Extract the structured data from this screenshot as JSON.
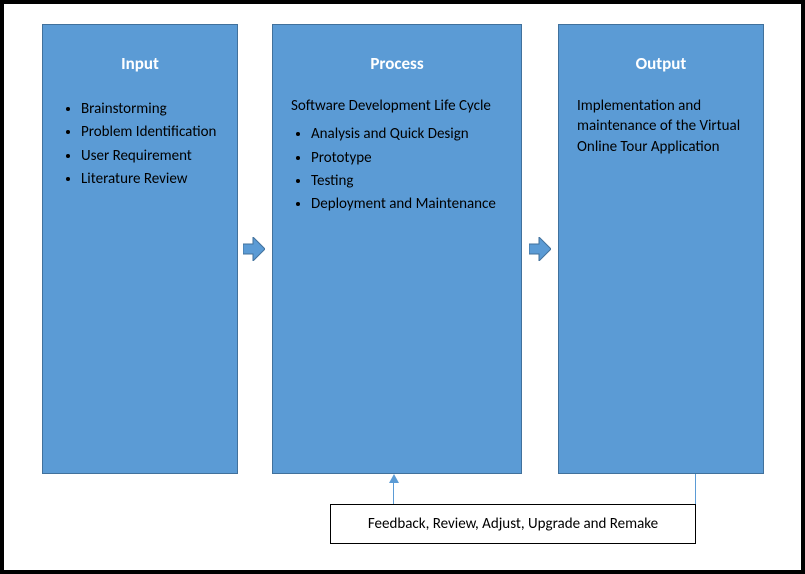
{
  "boxes": {
    "input": {
      "title": "Input",
      "items": [
        "Brainstorming",
        "Problem Identification",
        "User Requirement",
        "Literature Review"
      ]
    },
    "process": {
      "title": "Process",
      "subtext": "Software Development Life Cycle",
      "items": [
        "Analysis and Quick Design",
        "Prototype",
        "Testing",
        "Deployment and Maintenance"
      ]
    },
    "output": {
      "title": "Output",
      "text": "Implementation and maintenance of the Virtual Online Tour Application"
    }
  },
  "feedback": "Feedback, Review, Adjust, Upgrade and Remake",
  "colors": {
    "box_fill": "#5b9bd5",
    "box_border": "#41719c",
    "arrow_fill": "#5b9bd5"
  }
}
